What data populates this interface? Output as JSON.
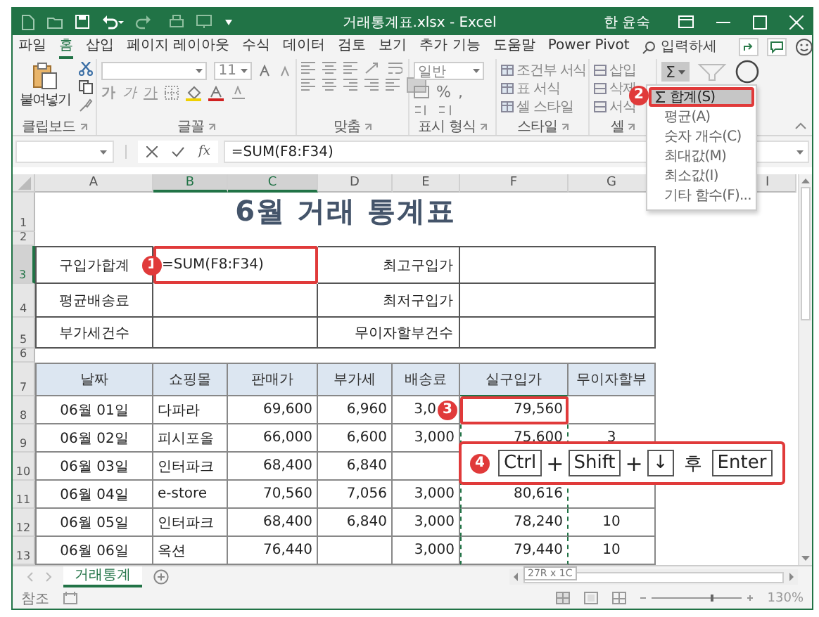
{
  "window": {
    "title": "거래통계표.xlsx - Excel",
    "user": "한 윤숙"
  },
  "ribbon_tabs": [
    {
      "label": "파일",
      "selected": false
    },
    {
      "label": "홈",
      "selected": true
    },
    {
      "label": "삽입",
      "selected": false
    },
    {
      "label": "페이지 레이아웃",
      "selected": false
    },
    {
      "label": "수식",
      "selected": false
    },
    {
      "label": "데이터",
      "selected": false
    },
    {
      "label": "검토",
      "selected": false
    },
    {
      "label": "보기",
      "selected": false
    },
    {
      "label": "추가 기능",
      "selected": false
    },
    {
      "label": "도움말",
      "selected": false
    },
    {
      "label": "Power Pivot",
      "selected": false
    }
  ],
  "tell_me": {
    "placeholder": "입력하세"
  },
  "ribbon": {
    "paste": "붙여넣기",
    "font_size": "11",
    "font_buttons": [
      "가",
      "가",
      "가"
    ],
    "number_format": "일반",
    "number_buttons": [
      "%",
      ","
    ],
    "style_buttons": [
      "조건부 서식",
      "표 서식",
      "셀 스타일"
    ],
    "cell_buttons": [
      "삽입",
      "삭제",
      "서식"
    ],
    "autosum": "Σ",
    "groups": [
      "클립보드",
      "글꼴",
      "맞춤",
      "표시 형식",
      "스타일",
      "셀"
    ]
  },
  "autosum_menu": [
    {
      "label": "합계(S)",
      "selected": true
    },
    {
      "label": "평균(A)",
      "selected": false
    },
    {
      "label": "숫자 개수(C)",
      "selected": false
    },
    {
      "label": "최대값(M)",
      "selected": false
    },
    {
      "label": "최소값(I)",
      "selected": false
    },
    {
      "label": "기타 함수(F)...",
      "selected": false
    }
  ],
  "menu_callout": "2",
  "formula_bar": {
    "function_label": "fx",
    "formula": "=SUM(F8:F34)"
  },
  "sheet": {
    "columns": [
      {
        "label": "A",
        "selected": false
      },
      {
        "label": "B",
        "selected": true
      },
      {
        "label": "C",
        "selected": true
      },
      {
        "label": "D",
        "selected": false
      },
      {
        "label": "E",
        "selected": false
      },
      {
        "label": "F",
        "selected": false
      },
      {
        "label": "G",
        "selected": false
      },
      {
        "label": "I",
        "selected": false
      }
    ],
    "row_numbers": [
      {
        "label": "1",
        "selected": false
      },
      {
        "label": "2",
        "selected": false
      },
      {
        "label": "3",
        "selected": true
      },
      {
        "label": "4",
        "selected": false
      },
      {
        "label": "5",
        "selected": false
      },
      {
        "label": "6",
        "selected": false
      },
      {
        "label": "7",
        "selected": false
      },
      {
        "label": "8",
        "selected": false
      },
      {
        "label": "9",
        "selected": false
      },
      {
        "label": "10",
        "selected": false
      },
      {
        "label": "11",
        "selected": false
      },
      {
        "label": "12",
        "selected": false
      },
      {
        "label": "13",
        "selected": false
      }
    ],
    "title": "6월 거래 통계표",
    "summary": [
      {
        "label": "구입가합계",
        "value": "=SUM(F8:F34)",
        "callout": "1",
        "label2": "최고구입가"
      },
      {
        "label": "평균배송료",
        "label2": "최저구입가"
      },
      {
        "label": "부가세건수",
        "label2": "무이자할부건수"
      }
    ],
    "table": {
      "headers": [
        {
          "label": "날짜",
          "marquee": false
        },
        {
          "label": "쇼핑몰",
          "marquee": false
        },
        {
          "label": "판매가",
          "marquee": false
        },
        {
          "label": "부가세",
          "marquee": false
        },
        {
          "label": "배송료",
          "marquee": false
        },
        {
          "label": "실구입가",
          "marquee": true
        },
        {
          "label": "무이자할부",
          "marquee": false
        }
      ],
      "rows": [
        {
          "cells": [
            "06월 01일",
            "다파라",
            "69,600",
            "6,960",
            "3,0",
            "79,560",
            null
          ],
          "callout": "3"
        },
        {
          "cells": [
            "06월 02일",
            "피시포올",
            "66,000",
            "6,600",
            "3,000",
            "75,600",
            "3"
          ]
        },
        {
          "cells": [
            "06월 03일",
            "인터파크",
            "68,400",
            "6,840",
            null,
            null,
            null
          ]
        },
        {
          "cells": [
            "06월 04일",
            "e-store",
            "70,560",
            "7,056",
            "3,000",
            "80,616",
            null
          ]
        },
        {
          "cells": [
            "06월 05일",
            "인터파크",
            "68,400",
            "6,840",
            "3,000",
            "78,240",
            "10"
          ]
        },
        {
          "cells": [
            "06월 06일",
            "옥션",
            "76,440",
            null,
            "3,000",
            "79,440",
            "10"
          ]
        }
      ]
    }
  },
  "key_hint": {
    "callout": "4",
    "items": [
      {
        "kind": "key",
        "text": "Ctrl"
      },
      {
        "kind": "plus",
        "text": "+"
      },
      {
        "kind": "key",
        "text": "Shift"
      },
      {
        "kind": "plus",
        "text": "+"
      },
      {
        "kind": "key",
        "text": "↓"
      },
      {
        "kind": "word",
        "text": "후"
      },
      {
        "kind": "key",
        "text": "Enter"
      }
    ]
  },
  "selection_tooltip": "27R x 1C",
  "sheet_tabs": [
    {
      "label": "거래통계",
      "selected": true
    }
  ],
  "status_bar": {
    "mode": "참조",
    "zoom": "130%"
  }
}
